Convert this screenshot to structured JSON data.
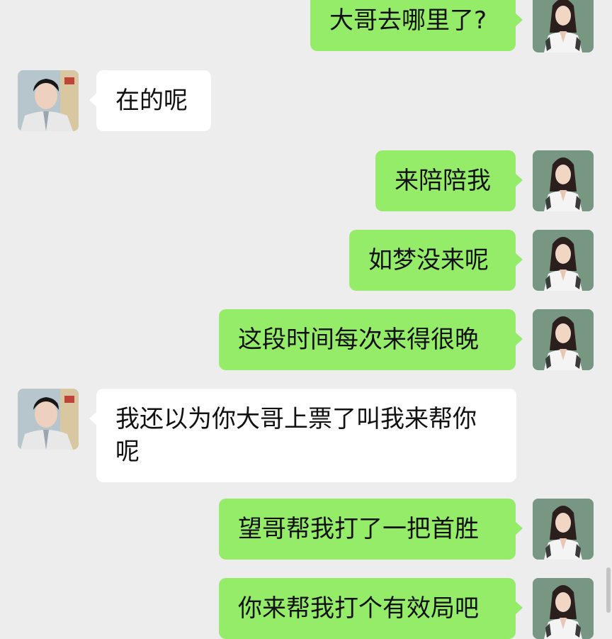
{
  "colors": {
    "background": "#ededed",
    "outgoing_bubble": "#95ec69",
    "incoming_bubble": "#ffffff"
  },
  "avatars": {
    "self": "woman-avatar",
    "contact": "man-avatar"
  },
  "messages": [
    {
      "sender": "self",
      "text": "大哥去哪里了?"
    },
    {
      "sender": "contact",
      "text": "在的呢"
    },
    {
      "sender": "self",
      "text": "来陪陪我"
    },
    {
      "sender": "self",
      "text": "如梦没来呢"
    },
    {
      "sender": "self",
      "text": "这段时间每次来得很晚"
    },
    {
      "sender": "contact",
      "text": "我还以为你大哥上票了叫我来帮你呢"
    },
    {
      "sender": "self",
      "text": "望哥帮我打了一把首胜"
    },
    {
      "sender": "self",
      "text": "你来帮我打个有效局吧"
    }
  ]
}
